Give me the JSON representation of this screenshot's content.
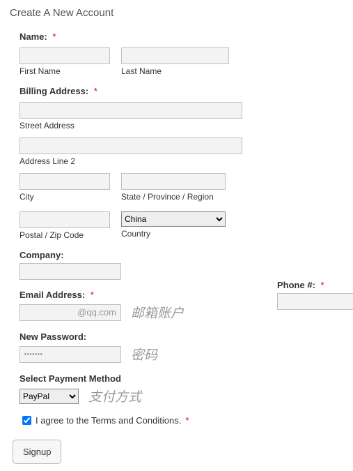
{
  "title": "Create A New Account",
  "name": {
    "label": "Name:",
    "first": {
      "value": "",
      "sublabel": "First Name"
    },
    "last": {
      "value": "",
      "sublabel": "Last Name"
    }
  },
  "billing": {
    "label": "Billing Address:",
    "street": {
      "value": "",
      "sublabel": "Street Address"
    },
    "line2": {
      "value": "",
      "sublabel": "Address Line 2"
    },
    "city": {
      "value": "",
      "sublabel": "City"
    },
    "state": {
      "value": "",
      "sublabel": "State / Province / Region"
    },
    "postal": {
      "value": "",
      "sublabel": "Postal / Zip Code"
    },
    "country": {
      "value": "China",
      "sublabel": "Country"
    }
  },
  "company": {
    "label": "Company:",
    "value": ""
  },
  "phone": {
    "label": "Phone #:",
    "value": ""
  },
  "email": {
    "label": "Email Address:",
    "value": "@qq.com",
    "annotation": "邮箱账户"
  },
  "password": {
    "label": "New Password:",
    "value": "•••••••",
    "annotation": "密码"
  },
  "payment": {
    "label": "Select Payment Method",
    "value": "PayPal",
    "annotation": "支付方式"
  },
  "terms": {
    "checked": true,
    "text": "I agree to the Terms and Conditions."
  },
  "signup_label": "Signup",
  "required_marker": "*"
}
